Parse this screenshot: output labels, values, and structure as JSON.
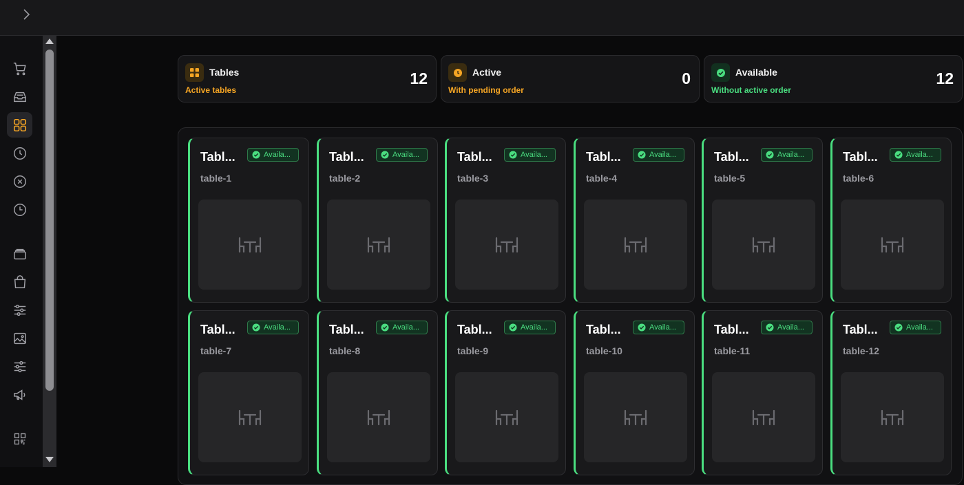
{
  "stats": [
    {
      "title": "Tables",
      "subtitle": "Active tables",
      "value": "12",
      "icon": "grid-icon",
      "accent": "#f5a524",
      "iconBg": "#3a2c10"
    },
    {
      "title": "Active",
      "subtitle": "With pending order",
      "value": "0",
      "icon": "clock-icon",
      "accent": "#f5a524",
      "iconBg": "#3a2c10"
    },
    {
      "title": "Available",
      "subtitle": "Without active order",
      "value": "12",
      "icon": "check-circle-icon",
      "accent": "#4ade80",
      "iconBg": "#12301f"
    }
  ],
  "tables": [
    {
      "name": "Tabl...",
      "slug": "table-1",
      "status": "Availa..."
    },
    {
      "name": "Tabl...",
      "slug": "table-2",
      "status": "Availa..."
    },
    {
      "name": "Tabl...",
      "slug": "table-3",
      "status": "Availa..."
    },
    {
      "name": "Tabl...",
      "slug": "table-4",
      "status": "Availa..."
    },
    {
      "name": "Tabl...",
      "slug": "table-5",
      "status": "Availa..."
    },
    {
      "name": "Tabl...",
      "slug": "table-6",
      "status": "Availa..."
    },
    {
      "name": "Tabl...",
      "slug": "table-7",
      "status": "Availa..."
    },
    {
      "name": "Tabl...",
      "slug": "table-8",
      "status": "Availa..."
    },
    {
      "name": "Tabl...",
      "slug": "table-9",
      "status": "Availa..."
    },
    {
      "name": "Tabl...",
      "slug": "table-10",
      "status": "Availa..."
    },
    {
      "name": "Tabl...",
      "slug": "table-11",
      "status": "Availa..."
    },
    {
      "name": "Tabl...",
      "slug": "table-12",
      "status": "Availa..."
    }
  ],
  "sidebar": {
    "items": [
      {
        "icon": "cart-icon"
      },
      {
        "icon": "inbox-icon"
      },
      {
        "icon": "tables-grid-icon",
        "active": true
      },
      {
        "icon": "clock-icon"
      },
      {
        "icon": "cancel-circle-icon"
      },
      {
        "icon": "history-clock-icon"
      },
      {
        "icon": "layers-icon"
      },
      {
        "icon": "shopping-bag-icon"
      },
      {
        "icon": "sliders-icon"
      },
      {
        "icon": "image-icon"
      },
      {
        "icon": "settings-sliders-icon"
      },
      {
        "icon": "megaphone-icon"
      },
      {
        "icon": "qr-code-icon"
      }
    ]
  },
  "colors": {
    "available": "#4ade80",
    "accent": "#f5a524"
  }
}
